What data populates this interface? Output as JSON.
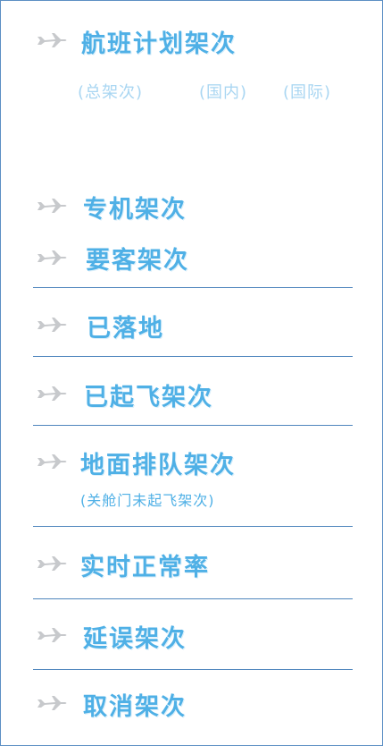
{
  "items": [
    {
      "label": "航班计划架次"
    },
    {
      "label": "专机架次"
    },
    {
      "label": "要客架次"
    },
    {
      "label": "已落地"
    },
    {
      "label": "已起飞架次"
    },
    {
      "label": "地面排队架次"
    },
    {
      "label": "实时正常率"
    },
    {
      "label": "延误架次"
    },
    {
      "label": "取消架次"
    }
  ],
  "plan_sub": {
    "total": "(总架次)",
    "domestic": "(国内)",
    "international": "(国际)"
  },
  "queue_sub": "(关舱门未起飞架次)",
  "colors": {
    "label": "#4fb0e6",
    "divider": "#4f86bd",
    "border": "#5c8fc4"
  },
  "icon": "airplane-icon"
}
